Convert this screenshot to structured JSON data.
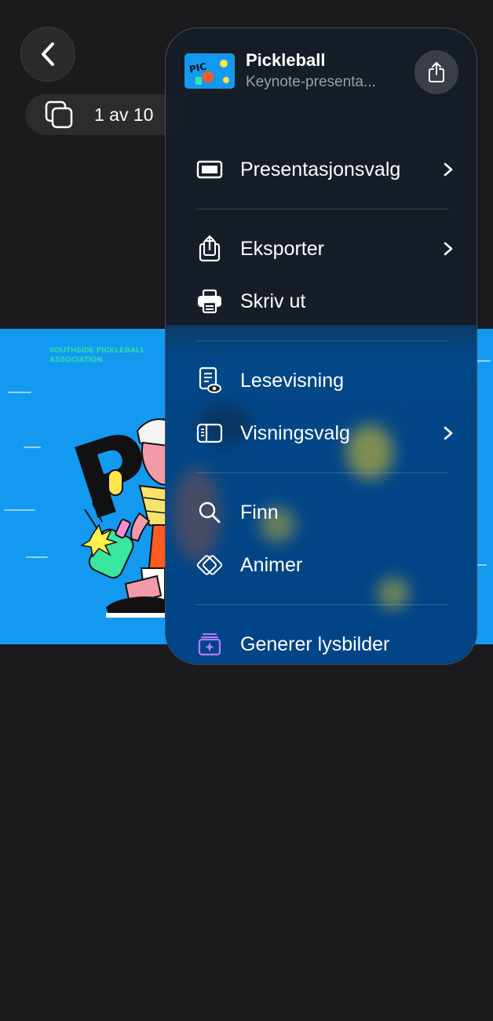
{
  "nav": {
    "slide_counter": "1 av 10"
  },
  "slide": {
    "org_line1": "SOUTHSIDE PICKLEBALL",
    "org_line2": "ASSOCIATION"
  },
  "document": {
    "title": "Pickleball",
    "subtitle": "Keynote-presenta..."
  },
  "menu": {
    "items": [
      {
        "label": "Presentasjonsvalg",
        "icon": "presentation-icon",
        "submenu": true
      },
      {
        "label": "Eksporter",
        "icon": "export-icon",
        "submenu": true
      },
      {
        "label": "Skriv ut",
        "icon": "printer-icon",
        "submenu": false
      },
      {
        "label": "Lesevisning",
        "icon": "reading-view-icon",
        "submenu": false
      },
      {
        "label": "Visningsvalg",
        "icon": "sidebar-icon",
        "submenu": true
      },
      {
        "label": "Finn",
        "icon": "search-icon",
        "submenu": false
      },
      {
        "label": "Animer",
        "icon": "animate-icon",
        "submenu": false
      },
      {
        "label": "Generer lysbilder",
        "icon": "sparkle-stack-icon",
        "submenu": false
      }
    ]
  },
  "colors": {
    "background": "#1b1b1d",
    "slide_blue": "#1499f0",
    "accent_purple": "#b07cff",
    "org_green": "#35e0a0"
  }
}
